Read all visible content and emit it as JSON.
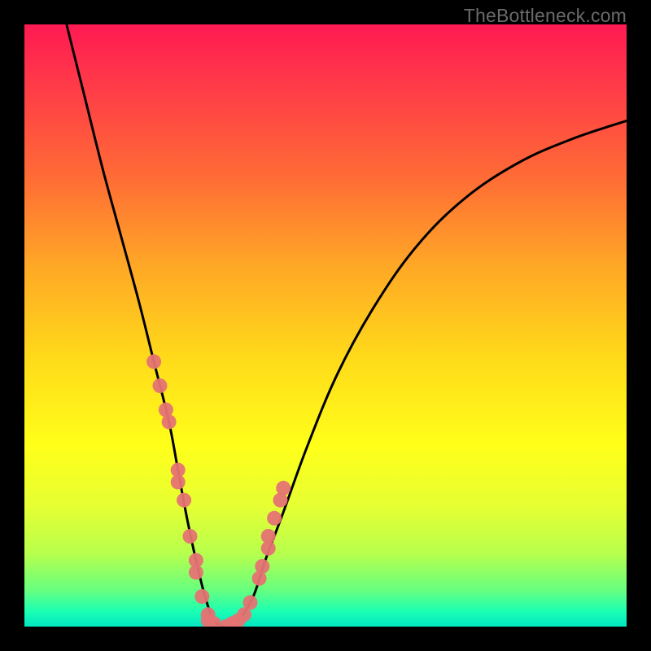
{
  "watermark": "TheBottleneck.com",
  "gradient": {
    "stops": [
      {
        "offset": 0.0,
        "color": "#ff1a52"
      },
      {
        "offset": 0.1,
        "color": "#ff3a48"
      },
      {
        "offset": 0.25,
        "color": "#ff6a36"
      },
      {
        "offset": 0.4,
        "color": "#ffa726"
      },
      {
        "offset": 0.55,
        "color": "#ffd91a"
      },
      {
        "offset": 0.7,
        "color": "#ffff1a"
      },
      {
        "offset": 0.8,
        "color": "#e6ff33"
      },
      {
        "offset": 0.88,
        "color": "#b6ff4d"
      },
      {
        "offset": 0.94,
        "color": "#66ff80"
      },
      {
        "offset": 0.975,
        "color": "#1affb3"
      },
      {
        "offset": 1.0,
        "color": "#00e6c2"
      }
    ]
  },
  "chart_data": {
    "type": "line",
    "title": "",
    "xlabel": "",
    "ylabel": "",
    "xlim": [
      0,
      1
    ],
    "ylim": [
      0,
      1
    ],
    "series": [
      {
        "name": "bottleneck-curve",
        "color": "#000000",
        "x": [
          0.07,
          0.1,
          0.13,
          0.16,
          0.19,
          0.215,
          0.24,
          0.255,
          0.27,
          0.285,
          0.3,
          0.315,
          0.335,
          0.355,
          0.38,
          0.4,
          0.43,
          0.47,
          0.52,
          0.58,
          0.65,
          0.73,
          0.82,
          0.91,
          1.0
        ],
        "y": [
          1.0,
          0.88,
          0.76,
          0.65,
          0.54,
          0.44,
          0.34,
          0.26,
          0.18,
          0.11,
          0.05,
          0.01,
          0.0,
          0.01,
          0.05,
          0.11,
          0.19,
          0.3,
          0.42,
          0.53,
          0.63,
          0.71,
          0.77,
          0.81,
          0.84
        ]
      }
    ],
    "scatter": {
      "name": "data-points",
      "color": "#e57373",
      "radius_px": 9,
      "x": [
        0.215,
        0.225,
        0.235,
        0.24,
        0.255,
        0.255,
        0.265,
        0.275,
        0.285,
        0.285,
        0.295,
        0.305,
        0.305,
        0.315,
        0.335,
        0.345,
        0.355,
        0.365,
        0.375,
        0.39,
        0.395,
        0.405,
        0.405,
        0.415,
        0.425,
        0.43
      ],
      "y": [
        0.44,
        0.4,
        0.36,
        0.34,
        0.26,
        0.24,
        0.21,
        0.15,
        0.11,
        0.09,
        0.05,
        0.02,
        0.01,
        0.005,
        0.0,
        0.005,
        0.01,
        0.02,
        0.04,
        0.08,
        0.1,
        0.13,
        0.15,
        0.18,
        0.21,
        0.23
      ]
    }
  }
}
